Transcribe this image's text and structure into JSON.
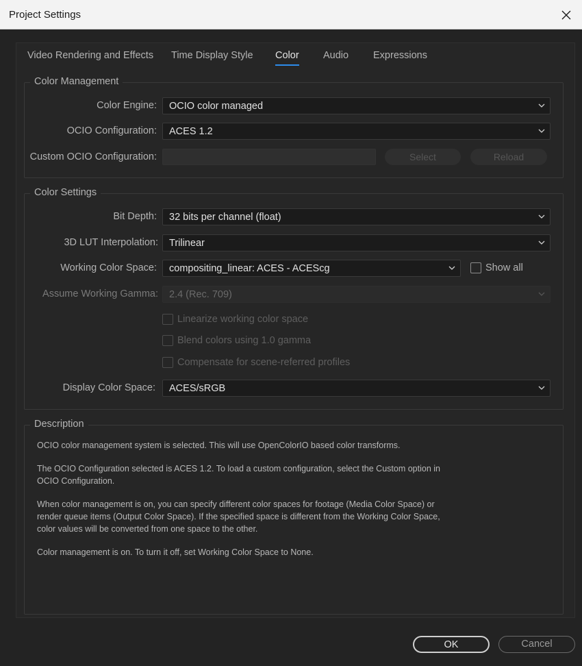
{
  "window": {
    "title": "Project Settings"
  },
  "tabs": [
    {
      "label": "Video Rendering and Effects"
    },
    {
      "label": "Time Display Style"
    },
    {
      "label": "Color",
      "active": true
    },
    {
      "label": "Audio"
    },
    {
      "label": "Expressions"
    }
  ],
  "color_management": {
    "legend": "Color Management",
    "engine_label": "Color Engine:",
    "engine_value": "OCIO color managed",
    "ocio_label": "OCIO Configuration:",
    "ocio_value": "ACES 1.2",
    "custom_label": "Custom OCIO Configuration:",
    "custom_value": "",
    "select_button": "Select",
    "reload_button": "Reload"
  },
  "color_settings": {
    "legend": "Color Settings",
    "bit_depth_label": "Bit Depth:",
    "bit_depth_value": "32 bits per channel (float)",
    "lut_label": "3D LUT Interpolation:",
    "lut_value": "Trilinear",
    "working_space_label": "Working Color Space:",
    "working_space_value": "compositing_linear: ACES - ACEScg",
    "show_all_label": "Show all",
    "gamma_label": "Assume Working Gamma:",
    "gamma_value": "2.4 (Rec. 709)",
    "linearize_label": "Linearize working color space",
    "blend_label": "Blend colors using 1.0 gamma",
    "compensate_label": "Compensate for scene-referred profiles",
    "display_space_label": "Display Color Space:",
    "display_space_value": "ACES/sRGB"
  },
  "description": {
    "legend": "Description",
    "paragraphs": [
      "OCIO color management system is selected. This will use OpenColorIO based color transforms.",
      "The OCIO Configuration selected is ACES 1.2. To load a custom configuration, select the Custom option in\nOCIO Configuration.",
      "When color management is on, you can specify different color spaces for footage (Media Color Space) or\nrender queue items (Output Color Space). If the specified space is different from the Working Color Space,\ncolor values will be converted from one space to the other.",
      "Color management is on. To turn it off, set Working Color Space to None."
    ]
  },
  "footer": {
    "ok": "OK",
    "cancel": "Cancel"
  },
  "colors": {
    "accent": "#2d8ceb",
    "background": "#232323",
    "titlebar": "#f3f3f3"
  },
  "icons": {
    "close": "close-icon",
    "dropdown": "chevron-down-icon"
  }
}
